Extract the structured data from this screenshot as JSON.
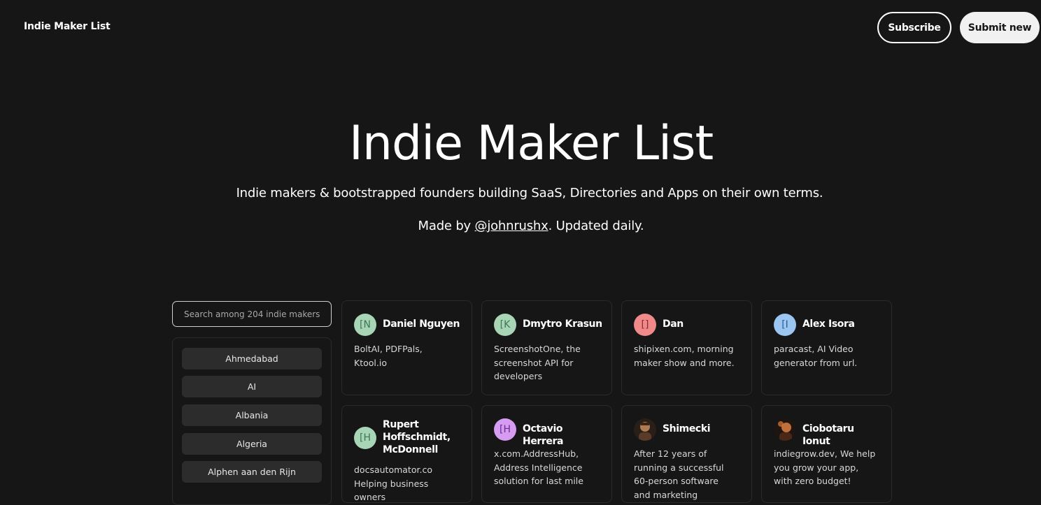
{
  "header": {
    "brand": "Indie Maker List",
    "subscribe_label": "Subscribe",
    "submit_label": "Submit new"
  },
  "hero": {
    "title": "Indie Maker List",
    "subtitle": "Indie makers & bootstrapped founders building SaaS, Directories and Apps on their own terms.",
    "made_by_prefix": "Made by ",
    "made_by_link": "@johnrushx",
    "made_by_suffix": ". Updated daily."
  },
  "search": {
    "placeholder": "Search among 204 indie makers",
    "value": ""
  },
  "filters": [
    {
      "label": "Ahmedabad"
    },
    {
      "label": "AI"
    },
    {
      "label": "Albania"
    },
    {
      "label": "Algeria"
    },
    {
      "label": "Alphen aan den Rijn"
    }
  ],
  "makers": [
    {
      "name": "Daniel Nguyen",
      "avatar_text": "[N",
      "avatar_bg": "#a8d5b5",
      "avatar_fg": "#3b7a52",
      "description": "BoltAI, PDFPals, Ktool.io"
    },
    {
      "name": "Dmytro Krasun",
      "avatar_text": "[K",
      "avatar_bg": "#a8d5b5",
      "avatar_fg": "#3b7a52",
      "description": "ScreenshotOne, the screenshot API for developers"
    },
    {
      "name": "Dan",
      "avatar_text": "[]",
      "avatar_bg": "#f08a8a",
      "avatar_fg": "#8a2a2a",
      "description": "shipixen.com, morning maker show and more."
    },
    {
      "name": "Alex Isora",
      "avatar_text": "[I",
      "avatar_bg": "#9cc6f2",
      "avatar_fg": "#2a5d94",
      "description": "paracast, AI Video generator from url."
    },
    {
      "name": "Rupert Hoffschmidt, McDonnell",
      "avatar_text": "[H",
      "avatar_bg": "#a8d5b5",
      "avatar_fg": "#3b7a52",
      "description": "docsautomator.co Helping business owners"
    },
    {
      "name": "Octavio Herrera",
      "avatar_text": "[H",
      "avatar_bg": "#d59cf2",
      "avatar_fg": "#6d2a94",
      "description": "x.com.AddressHub, Address Intelligence solution for last mile"
    },
    {
      "name": "Shimecki",
      "avatar_text": "",
      "avatar_bg": "#3a2a20",
      "avatar_fg": "#c98a5a",
      "description": "After 12 years of running a successful 60-person software and marketing"
    },
    {
      "name": "Ciobotaru Ionut",
      "avatar_text": "",
      "avatar_bg": "#2a1a14",
      "avatar_fg": "#e07a3a",
      "description": "indiegrow.dev, We help you grow your app, with zero budget!"
    }
  ]
}
